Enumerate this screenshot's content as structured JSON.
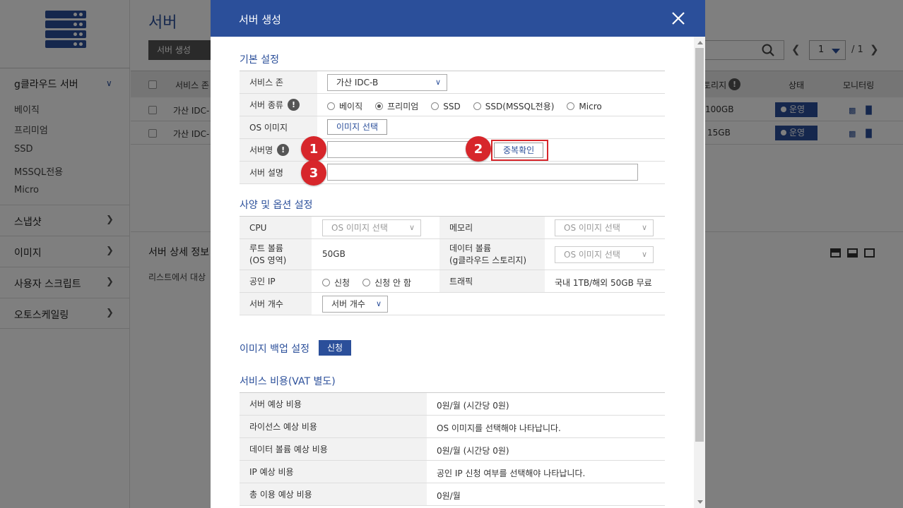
{
  "app": {
    "page_title": "서버",
    "create_button": "서버 생성",
    "pager": {
      "current": "1",
      "total": "/ 1"
    },
    "sidebar": {
      "group_title": "g클라우드 서버",
      "sub_items": [
        "베이직",
        "프리미엄",
        "SSD",
        "MSSQL전용",
        "Micro"
      ],
      "menus": [
        "스냅샷",
        "이미지",
        "사용자 스크립트",
        "오토스케일링"
      ]
    },
    "table": {
      "headers": {
        "zone": "서비스 존",
        "storage": "토리지",
        "status": "상태",
        "monitoring": "모니터링"
      },
      "rows": [
        {
          "zone": "가산 IDC-",
          "storage": "100GB",
          "status": "운영"
        },
        {
          "zone": "가산 IDC-",
          "storage": "15GB",
          "status": "운영"
        }
      ]
    },
    "detail": {
      "title": "서버 상세 정보",
      "text": "리스트에서 대상"
    }
  },
  "modal": {
    "title": "서버 생성",
    "basic": {
      "title": "기본 설정",
      "zone_label": "서비스 존",
      "zone_value": "가산 IDC-B",
      "type_label": "서버 종류",
      "type_options": [
        "베이직",
        "프리미엄",
        "SSD",
        "SSD(MSSQL전용)",
        "Micro"
      ],
      "type_selected": "프리미엄",
      "os_label": "OS 이미지",
      "os_button": "이미지 선택",
      "name_label": "서버명",
      "name_value": "",
      "dup_check": "중복확인",
      "desc_label": "서버 설명",
      "desc_value": ""
    },
    "markers": [
      "1",
      "2",
      "3"
    ],
    "spec": {
      "title": "사양 및 옵션 설정",
      "cpu_label": "CPU",
      "cpu_value": "OS 이미지 선택",
      "memory_label": "메모리",
      "memory_value": "OS 이미지 선택",
      "root_label_1": "루트 볼륨",
      "root_label_2": "(OS 영역)",
      "root_value": "50GB",
      "data_label_1": "데이터 볼륨",
      "data_label_2": "(g클라우드 스토리지)",
      "data_value": "OS 이미지 선택",
      "ip_label": "공인 IP",
      "ip_options": [
        "신청",
        "신청 안 함"
      ],
      "traffic_label": "트래픽",
      "traffic_value": "국내 1TB/해외 50GB 무료",
      "count_label": "서버 개수",
      "count_value": "서버 개수"
    },
    "backup": {
      "title": "이미지 백업 설정",
      "button": "신청"
    },
    "cost": {
      "title": "서비스 비용(VAT 별도)",
      "rows": [
        {
          "label": "서버 예상 비용",
          "value": "0원/월 (시간당 0원)"
        },
        {
          "label": "라이선스 예상 비용",
          "value": "OS 이미지를 선택해야 나타납니다."
        },
        {
          "label": "데이터 볼륨 예상 비용",
          "value": "0원/월 (시간당 0원)"
        },
        {
          "label": "IP 예상 비용",
          "value": "공인 IP 신청 여부를 선택해야 나타납니다."
        },
        {
          "label": "총 이용 예상 비용",
          "value": "0원/월"
        }
      ]
    }
  },
  "colors": {
    "brand": "#2b4f9a",
    "marker": "#d7262b",
    "status": "#2b4f9a"
  }
}
